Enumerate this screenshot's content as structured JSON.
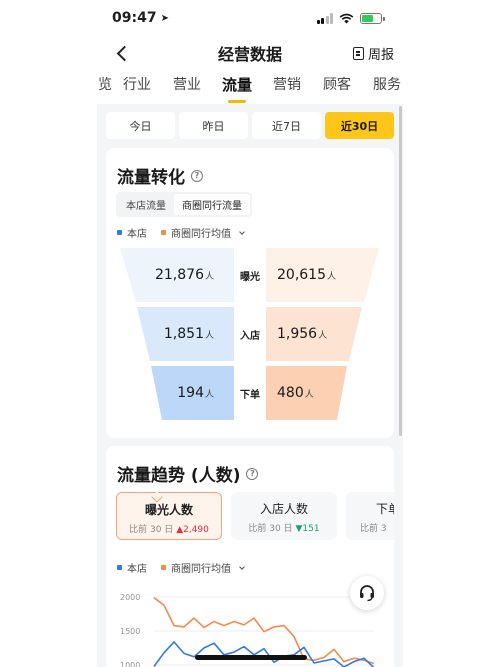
{
  "status_bar": {
    "time": "09:47"
  },
  "nav": {
    "title": "经营数据",
    "report_label": "周报"
  },
  "main_tabs": [
    "总览",
    "行业",
    "营业",
    "流量",
    "营销",
    "顾客",
    "服务"
  ],
  "main_tabs_visible": [
    "览",
    "行业",
    "营业",
    "流量",
    "营销",
    "顾客",
    "服务"
  ],
  "active_main_tab": "流量",
  "date_tabs": [
    "今日",
    "昨日",
    "近7日",
    "近30日"
  ],
  "active_date_tab": "近30日",
  "conversion": {
    "title": "流量转化",
    "toggle": [
      "本店流量",
      "商圈同行流量"
    ],
    "legend": {
      "store": "本店",
      "peer": "商圈同行均值"
    },
    "unit": "人",
    "stages": [
      {
        "label": "曝光",
        "store": "21,876",
        "peer": "20,615"
      },
      {
        "label": "入店",
        "store": "1,851",
        "peer": "1,956"
      },
      {
        "label": "下单",
        "store": "194",
        "peer": "480"
      }
    ]
  },
  "trend": {
    "title": "流量趋势 (人数)",
    "metrics": [
      {
        "name": "曝光人数",
        "compare": "比前 30 日",
        "delta": "2,490",
        "direction": "up"
      },
      {
        "name": "入店人数",
        "compare": "比前 30 日",
        "delta": "151",
        "direction": "down"
      },
      {
        "name": "下单",
        "compare": "比前 3"
      }
    ],
    "legend": {
      "store": "本店",
      "peer": "商圈同行均值"
    },
    "y_ticks": [
      "2000",
      "1500",
      "1000"
    ]
  },
  "colors": {
    "accent": "#ffc61a",
    "store": "#2f7be6",
    "peer": "#f28c4a"
  },
  "chart_data": {
    "type": "line",
    "ylim": [
      1000,
      2000
    ],
    "series": [
      {
        "name": "商圈同行均值",
        "values": [
          1990,
          1880,
          1580,
          1560,
          1690,
          1550,
          1640,
          1580,
          1640,
          1590,
          1690,
          1490,
          1560,
          1580,
          1420,
          1090,
          1070,
          1110,
          1230,
          1050,
          1100,
          1070,
          1020
        ]
      },
      {
        "name": "本店",
        "values": [
          980,
          1180,
          1340,
          1170,
          1120,
          1250,
          1320,
          1150,
          1190,
          1270,
          1150,
          1240,
          1040,
          1130,
          1150,
          1260,
          1030,
          1060,
          1090,
          970,
          1050,
          1100,
          960
        ]
      }
    ]
  }
}
